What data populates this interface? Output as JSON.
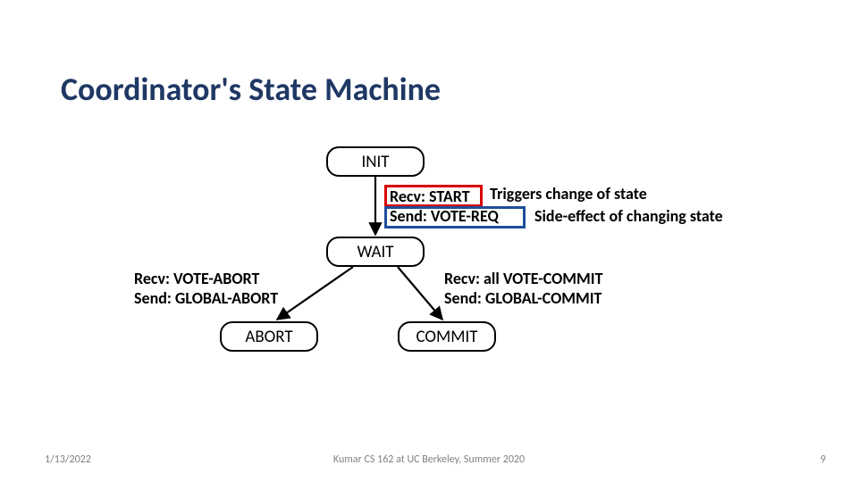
{
  "title": "Coordinator's State Machine",
  "nodes": {
    "init": "INIT",
    "wait": "WAIT",
    "abort": "ABORT",
    "commit": "COMMIT"
  },
  "edges": {
    "init_wait": {
      "recv": "Recv: START",
      "send": "Send: VOTE-REQ"
    },
    "wait_abort": {
      "recv": "Recv: VOTE-ABORT",
      "send": "Send: GLOBAL-ABORT"
    },
    "wait_commit": {
      "recv": "Recv: all VOTE-COMMIT",
      "send": "Send: GLOBAL-COMMIT"
    }
  },
  "annotations": {
    "trigger": "Triggers change of state",
    "side_effect": "Side-effect of changing state"
  },
  "footer": {
    "date": "1/13/2022",
    "center": "Kumar CS 162 at UC Berkeley, Summer 2020",
    "page": "9"
  },
  "chart_data": {
    "type": "state_machine",
    "states": [
      "INIT",
      "WAIT",
      "ABORT",
      "COMMIT"
    ],
    "transitions": [
      {
        "from": "INIT",
        "to": "WAIT",
        "recv": "START",
        "send": "VOTE-REQ"
      },
      {
        "from": "WAIT",
        "to": "ABORT",
        "recv": "VOTE-ABORT",
        "send": "GLOBAL-ABORT"
      },
      {
        "from": "WAIT",
        "to": "COMMIT",
        "recv": "all VOTE-COMMIT",
        "send": "GLOBAL-COMMIT"
      }
    ],
    "legend": {
      "Recv": "Triggers change of state",
      "Send": "Side-effect of changing state"
    }
  }
}
